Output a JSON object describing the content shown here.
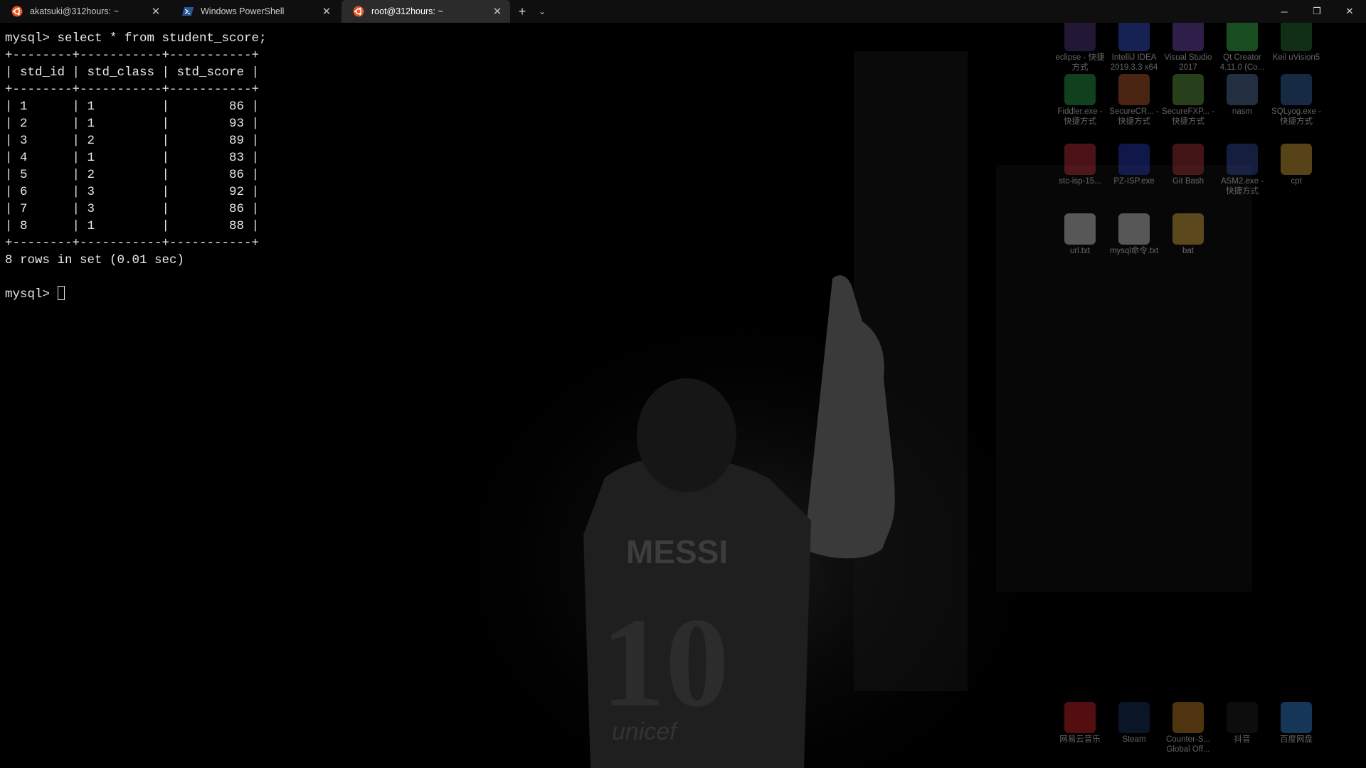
{
  "tabs": [
    {
      "label": "akatsuki@312hours: ~",
      "icon": "ubuntu-icon",
      "active": false
    },
    {
      "label": "Windows PowerShell",
      "icon": "powershell-icon",
      "active": false
    },
    {
      "label": "root@312hours: ~",
      "icon": "ubuntu-icon",
      "active": true
    }
  ],
  "tabbar": {
    "new_tab": "+",
    "dropdown": "⌄"
  },
  "window_controls": {
    "minimize": "─",
    "restore": "❐",
    "close": "✕"
  },
  "terminal": {
    "command_line": "mysql> select * from student_score;",
    "border": "+--------+-----------+-----------+",
    "header": "| std_id | std_class | std_score |",
    "rows": [
      "| 1      | 1         |        86 |",
      "| 2      | 1         |        93 |",
      "| 3      | 2         |        89 |",
      "| 4      | 1         |        83 |",
      "| 5      | 2         |        86 |",
      "| 6      | 3         |        92 |",
      "| 7      | 3         |        86 |",
      "| 8      | 1         |        88 |"
    ],
    "result": "8 rows in set (0.01 sec)",
    "prompt": "mysql> "
  },
  "wallpaper": {
    "jersey_name": "MESSI",
    "jersey_number": "10",
    "sponsor": "unicef"
  },
  "desktop_icons": [
    {
      "label": "eclipse - 快捷方式",
      "icon": "eclipse-icon",
      "color": "#5a3f8f"
    },
    {
      "label": "IntelliJ IDEA 2019.3.3 x64",
      "icon": "intellij-icon",
      "color": "#3a5bd9"
    },
    {
      "label": "Visual Studio 2017",
      "icon": "visual-studio-icon",
      "color": "#7a4fbf"
    },
    {
      "label": "Qt Creator 4.11.0 (Co...",
      "icon": "qt-creator-icon",
      "color": "#41cd52"
    },
    {
      "label": "Keil uVision5",
      "icon": "keil-icon",
      "color": "#2f7d3a"
    },
    {
      "label": "Fiddler.exe - 快捷方式",
      "icon": "fiddler-icon",
      "color": "#2fa84f"
    },
    {
      "label": "SecureCR... - 快捷方式",
      "icon": "securecrt-icon",
      "color": "#c06030"
    },
    {
      "label": "SecureFXP... - 快捷方式",
      "icon": "securefx-icon",
      "color": "#6aa64a"
    },
    {
      "label": "nasm",
      "icon": "nasm-icon",
      "color": "#5c7ca8"
    },
    {
      "label": "SQLyog.exe - 快捷方式",
      "icon": "sqlyog-icon",
      "color": "#3d6fb0"
    },
    {
      "label": "stc-isp-15...",
      "icon": "stc-isp-icon",
      "color": "#c8323a"
    },
    {
      "label": "PZ-ISP.exe",
      "icon": "pz-isp-icon",
      "color": "#2a3fbf"
    },
    {
      "label": "Git Bash",
      "icon": "git-bash-icon",
      "color": "#b0363a"
    },
    {
      "label": "ASM2.exe - 快捷方式",
      "icon": "asm2-icon",
      "color": "#3a4fa8"
    },
    {
      "label": "cpt",
      "icon": "folder-icon",
      "color": "#e3b341"
    },
    {
      "label": "url.txt",
      "icon": "text-file-icon",
      "color": "#d8d8d8"
    },
    {
      "label": "mysql命令.txt",
      "icon": "text-file-icon",
      "color": "#d8d8d8"
    },
    {
      "label": "bat",
      "icon": "folder-icon",
      "color": "#e3b341"
    },
    {
      "label": "网易云音乐",
      "icon": "netease-music-icon",
      "color": "#e0262a"
    },
    {
      "label": "Steam",
      "icon": "steam-icon",
      "color": "#1b3a66"
    },
    {
      "label": "Counter-S... Global Off...",
      "icon": "csgo-icon",
      "color": "#d08a2a"
    },
    {
      "label": "抖音",
      "icon": "douyin-icon",
      "color": "#222222"
    },
    {
      "label": "百度网盘",
      "icon": "baidu-netdisk-icon",
      "color": "#3a8fe8"
    }
  ]
}
